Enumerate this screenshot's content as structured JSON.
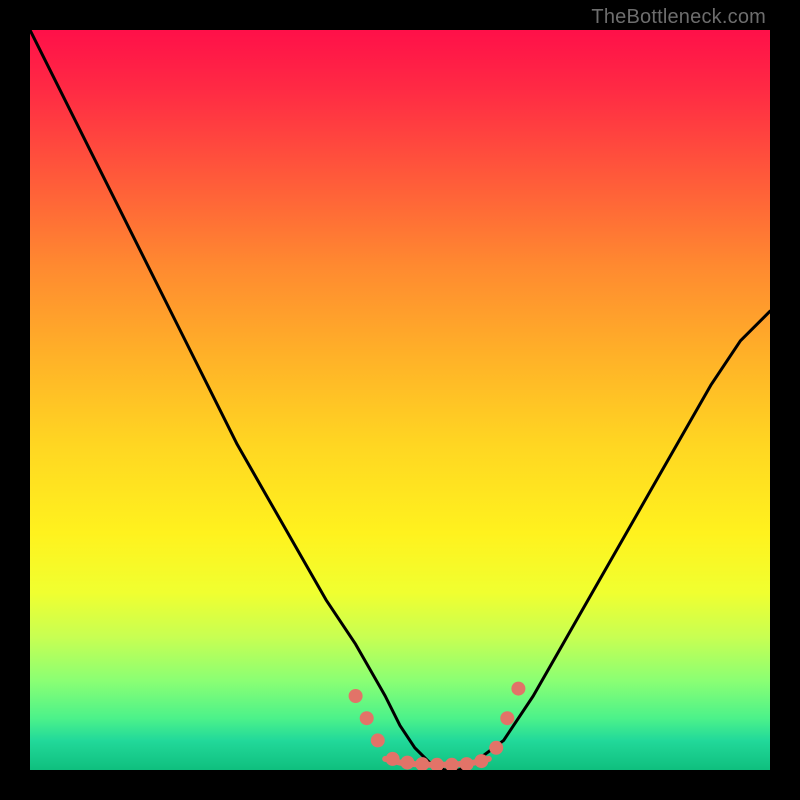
{
  "watermark": "TheBottleneck.com",
  "colors": {
    "frame": "#000000",
    "curve": "#000000",
    "markers": "#e27368",
    "gradient_top": "#ff1049",
    "gradient_bottom": "#0fbf7e"
  },
  "chart_data": {
    "type": "line",
    "title": "",
    "xlabel": "",
    "ylabel": "",
    "xlim": [
      0,
      100
    ],
    "ylim": [
      0,
      100
    ],
    "grid": false,
    "legend": false,
    "annotations": [
      "TheBottleneck.com"
    ],
    "series": [
      {
        "name": "bottleneck-curve",
        "x": [
          0,
          4,
          8,
          12,
          16,
          20,
          24,
          28,
          32,
          36,
          40,
          44,
          48,
          50,
          52,
          54,
          56,
          58,
          60,
          64,
          68,
          72,
          76,
          80,
          84,
          88,
          92,
          96,
          100
        ],
        "y": [
          100,
          92,
          84,
          76,
          68,
          60,
          52,
          44,
          37,
          30,
          23,
          17,
          10,
          6,
          3,
          1,
          0,
          0,
          1,
          4,
          10,
          17,
          24,
          31,
          38,
          45,
          52,
          58,
          62
        ]
      },
      {
        "name": "flat-segment",
        "x": [
          48,
          50,
          52,
          54,
          56,
          58,
          60,
          62
        ],
        "y": [
          1.5,
          1,
          0.8,
          0.7,
          0.7,
          0.8,
          1,
          1.5
        ]
      }
    ],
    "markers": [
      {
        "x": 44,
        "y": 10
      },
      {
        "x": 45.5,
        "y": 7
      },
      {
        "x": 47,
        "y": 4
      },
      {
        "x": 49,
        "y": 1.5
      },
      {
        "x": 51,
        "y": 1
      },
      {
        "x": 53,
        "y": 0.8
      },
      {
        "x": 55,
        "y": 0.7
      },
      {
        "x": 57,
        "y": 0.7
      },
      {
        "x": 59,
        "y": 0.8
      },
      {
        "x": 61,
        "y": 1.2
      },
      {
        "x": 63,
        "y": 3
      },
      {
        "x": 64.5,
        "y": 7
      },
      {
        "x": 66,
        "y": 11
      }
    ]
  }
}
